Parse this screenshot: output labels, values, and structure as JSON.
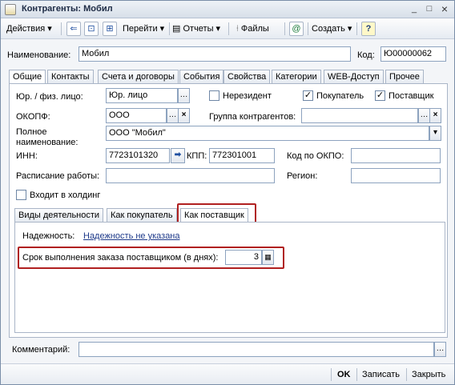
{
  "window": {
    "title": "Контрагенты: Мобил",
    "minimize": "_",
    "maximize": "□",
    "close": "×"
  },
  "toolbar": {
    "actions": "Действия",
    "goto": "Перейти",
    "reports": "Отчеты",
    "files": "Файлы",
    "create": "Создать",
    "help": "?"
  },
  "form": {
    "name_label": "Наименование:",
    "name_value": "Мобил",
    "code_label": "Код:",
    "code_value": "Ю00000062"
  },
  "tabs": [
    "Общие",
    "Контакты",
    "Счета и договоры",
    "События",
    "Свойства",
    "Категории",
    "WEB-Доступ",
    "Прочее"
  ],
  "general": {
    "legal_label": "Юр. / физ. лицо:",
    "legal_value": "Юр. лицо",
    "nonresident": "Нерезидент",
    "buyer": "Покупатель",
    "supplier": "Поставщик",
    "okopf_label": "ОКОПФ:",
    "okopf_value": "ООО",
    "group_label": "Группа контрагентов:",
    "fullname_label": "Полное наименование:",
    "fullname_value": "ООО \"Мобил\"",
    "inn_label": "ИНН:",
    "inn_value": "7723101320",
    "kpp_label": "КПП:",
    "kpp_value": "772301001",
    "okpo_label": "Код по ОКПО:",
    "schedule_label": "Расписание работы:",
    "region_label": "Регион:",
    "holding_label": "Входит в холдинг"
  },
  "subtabs": [
    "Виды деятельности",
    "Как покупатель",
    "Как поставщик"
  ],
  "supplier_tab": {
    "reliability_label": "Надежность:",
    "reliability_value": "Надежность не указана",
    "term_label": "Срок выполнения заказа поставщиком (в днях):",
    "term_value": "3"
  },
  "comment_label": "Комментарий:",
  "footer": {
    "ok": "OK",
    "save": "Записать",
    "close": "Закрыть"
  }
}
